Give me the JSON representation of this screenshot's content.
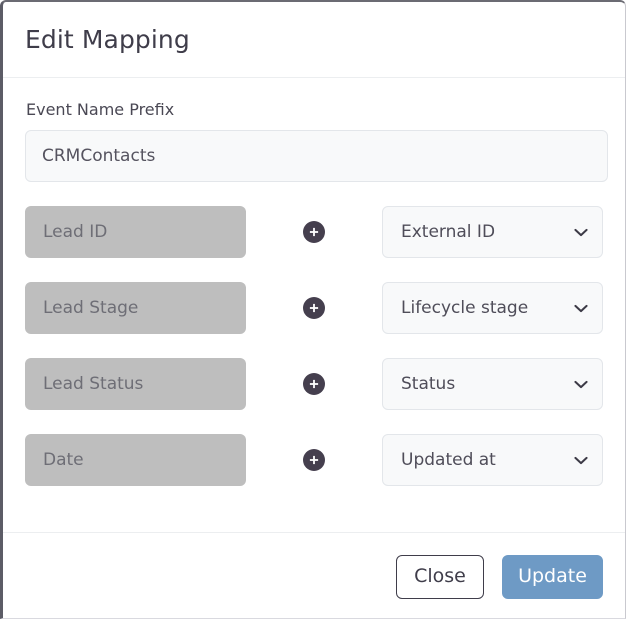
{
  "dialog": {
    "title": "Edit Mapping"
  },
  "form": {
    "prefix_label": "Event Name Prefix",
    "prefix_value": "CRMContacts",
    "prefix_placeholder": "Event Name Prefix"
  },
  "mappings": [
    {
      "source": "Lead ID",
      "destination": "External ID",
      "link_icon": "plus-icon"
    },
    {
      "source": "Lead Stage",
      "destination": "Lifecycle stage",
      "link_icon": "plus-icon"
    },
    {
      "source": "Lead Status",
      "destination": "Status",
      "link_icon": "plus-icon"
    },
    {
      "source": "Date",
      "destination": "Updated at",
      "link_icon": "plus-icon"
    }
  ],
  "footer": {
    "close_label": "Close",
    "update_label": "Update"
  },
  "colors": {
    "update_button": "#6e9ac5",
    "source_field": "#bebebe",
    "icon_circle": "#453f4e",
    "title_text": "#3f3d4a"
  }
}
